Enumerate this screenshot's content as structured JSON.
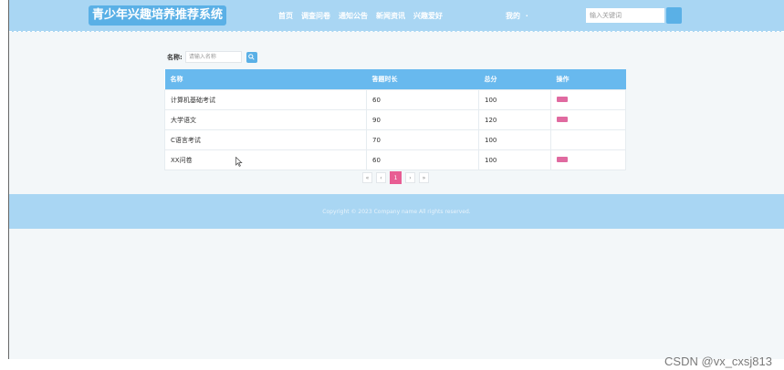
{
  "header": {
    "logo": "青少年兴趣培养推荐系统",
    "nav": [
      "首页",
      "调查问卷",
      "通知公告",
      "新闻资讯",
      "兴趣爱好"
    ],
    "mine_label": "我的",
    "search_placeholder": "输入关键词",
    "colors": {
      "bar": "#a9d6f3",
      "accent": "#5ab0e6"
    }
  },
  "filter": {
    "label": "名称:",
    "placeholder": "请输入名称",
    "button_icon": "search-icon"
  },
  "table": {
    "headers": [
      "名称",
      "答题时长",
      "总分",
      "操作"
    ],
    "rows": [
      {
        "name": "计算机基础考试",
        "duration": "60",
        "score": "100",
        "has_action": true
      },
      {
        "name": "大学语文",
        "duration": "90",
        "score": "120",
        "has_action": true
      },
      {
        "name": "C语言考试",
        "duration": "70",
        "score": "100",
        "has_action": false
      },
      {
        "name": "XX问卷",
        "duration": "60",
        "score": "100",
        "has_action": true
      }
    ],
    "colors": {
      "header": "#68b9ee",
      "action": "#e06aa0"
    }
  },
  "pagination": {
    "first": "«",
    "prev": "‹",
    "current": "1",
    "next": "›",
    "last": "»"
  },
  "footer": {
    "text": "Copyright © 2023 Company name All rights reserved."
  },
  "watermark": "CSDN @vx_cxsj813"
}
